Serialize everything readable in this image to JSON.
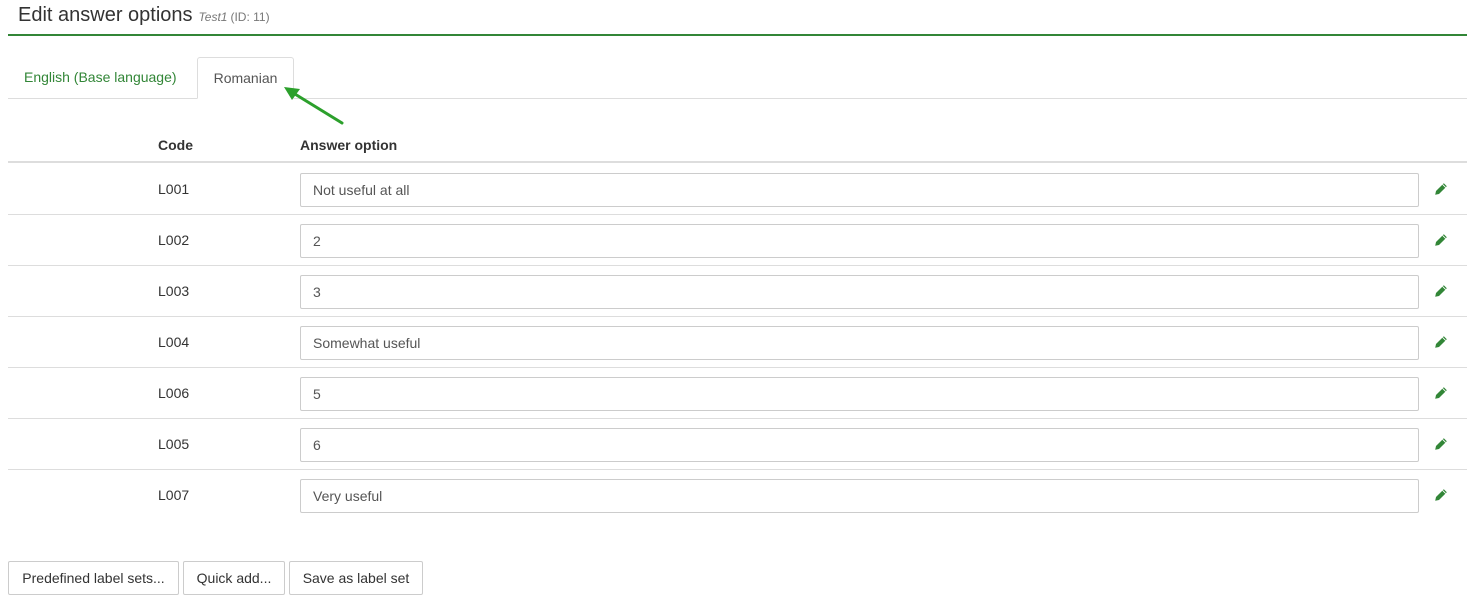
{
  "header": {
    "title": "Edit answer options",
    "survey_name": "Test1",
    "survey_id": "(ID: 11)"
  },
  "tabs": [
    {
      "label": "English (Base language)",
      "active": false
    },
    {
      "label": "Romanian",
      "active": true
    }
  ],
  "table": {
    "columns": {
      "code": "Code",
      "answer": "Answer option"
    },
    "rows": [
      {
        "code": "L001",
        "answer": "Not useful at all"
      },
      {
        "code": "L002",
        "answer": "2"
      },
      {
        "code": "L003",
        "answer": "3"
      },
      {
        "code": "L004",
        "answer": "Somewhat useful"
      },
      {
        "code": "L006",
        "answer": "5"
      },
      {
        "code": "L005",
        "answer": "6"
      },
      {
        "code": "L007",
        "answer": "Very useful"
      }
    ]
  },
  "buttons": {
    "predefined": "Predefined label sets...",
    "quick_add": "Quick add...",
    "save_label_set": "Save as label set"
  },
  "colors": {
    "accent": "#328637",
    "arrow": "#2ca02c"
  },
  "icons": {
    "row_action": "pencil-icon",
    "annotation": "arrow-icon"
  }
}
